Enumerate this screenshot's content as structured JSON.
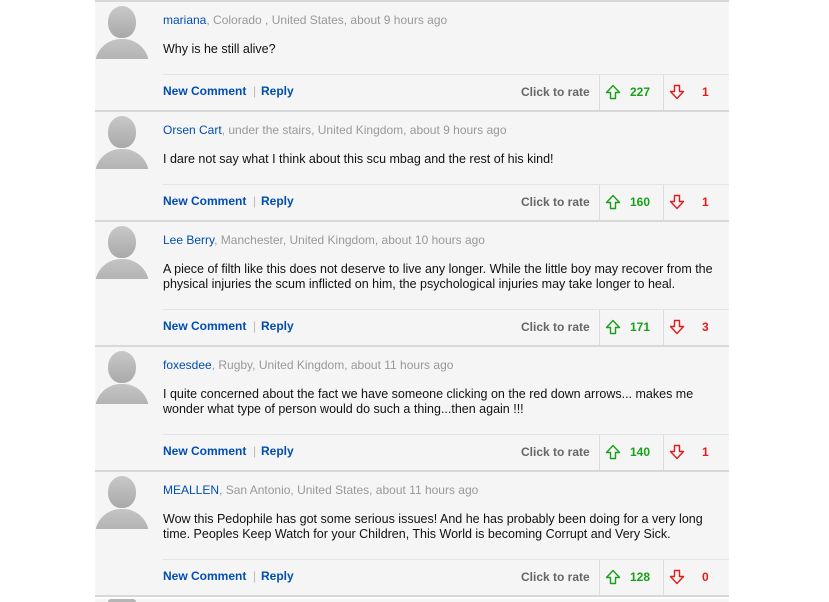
{
  "action_labels": {
    "new_comment": "New Comment",
    "separator": "|",
    "reply": "Reply",
    "rate": "Click to rate"
  },
  "colors": {
    "link": "#004db3",
    "up": "#1a9f1a",
    "down": "#e01b1b"
  },
  "comments": [
    {
      "author": "mariana",
      "location": ", Colorado , United States, about 9 hours ago",
      "body": "Why is he still alive?",
      "up": "227",
      "down": "1"
    },
    {
      "author": "Orsen Cart",
      "location": ", under the stairs, United Kingdom, about 9 hours ago",
      "body": "I dare not say what I think about this scu mbag and the rest of his kind!",
      "up": "160",
      "down": "1"
    },
    {
      "author": "Lee Berry",
      "location": ", Manchester, United Kingdom, about 10 hours ago",
      "body": "A piece of filth like this does not deserve to live any longer. While the little boy may recover from the physical injuries the scum inflicted on him, the psychological injuries may take longer to heal.",
      "up": "171",
      "down": "3"
    },
    {
      "author": "foxesdee",
      "location": ", Rugby, United Kingdom, about 11 hours ago",
      "body": "I quite concerned about the fact we have someone clicking on the red down arrows... makes me wonder what type of person would do such a thing...then again !!!",
      "up": "140",
      "down": "1"
    },
    {
      "author": "MEALLEN",
      "location": ", San Antonio, United States, about 11 hours ago",
      "body": "Wow this Pedophile has got some serious issues! And he has probably been doing for a very long time. Peoples Keep Watch for your Children, This World is becoming Corrupt and Very Sick.",
      "up": "128",
      "down": "0"
    }
  ]
}
